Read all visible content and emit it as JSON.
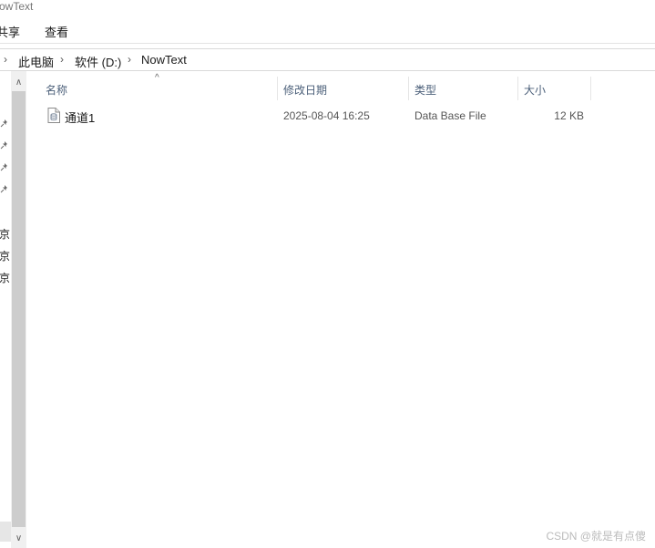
{
  "window": {
    "title": "owText"
  },
  "ribbon": {
    "tabs": [
      {
        "label": "共享"
      },
      {
        "label": "查看"
      }
    ]
  },
  "address_bar": {
    "breadcrumbs": [
      {
        "label": "此电脑"
      },
      {
        "label": "软件 (D:)"
      },
      {
        "label": "NowText"
      }
    ]
  },
  "nav_pane": {
    "pinned_icon": "pin-icon",
    "items": [
      {
        "label": "京"
      },
      {
        "label": "京"
      },
      {
        "label": "京"
      }
    ]
  },
  "file_list": {
    "columns": [
      {
        "label": "名称"
      },
      {
        "label": "修改日期"
      },
      {
        "label": "类型"
      },
      {
        "label": "大小"
      }
    ],
    "sort_indicator": "^",
    "rows": [
      {
        "icon": "database-file-icon",
        "name": "通道1",
        "modified": "2025-08-04 16:25",
        "type": "Data Base File",
        "size": "12 KB"
      }
    ]
  },
  "watermark": {
    "text": "CSDN @就是有点傻"
  }
}
